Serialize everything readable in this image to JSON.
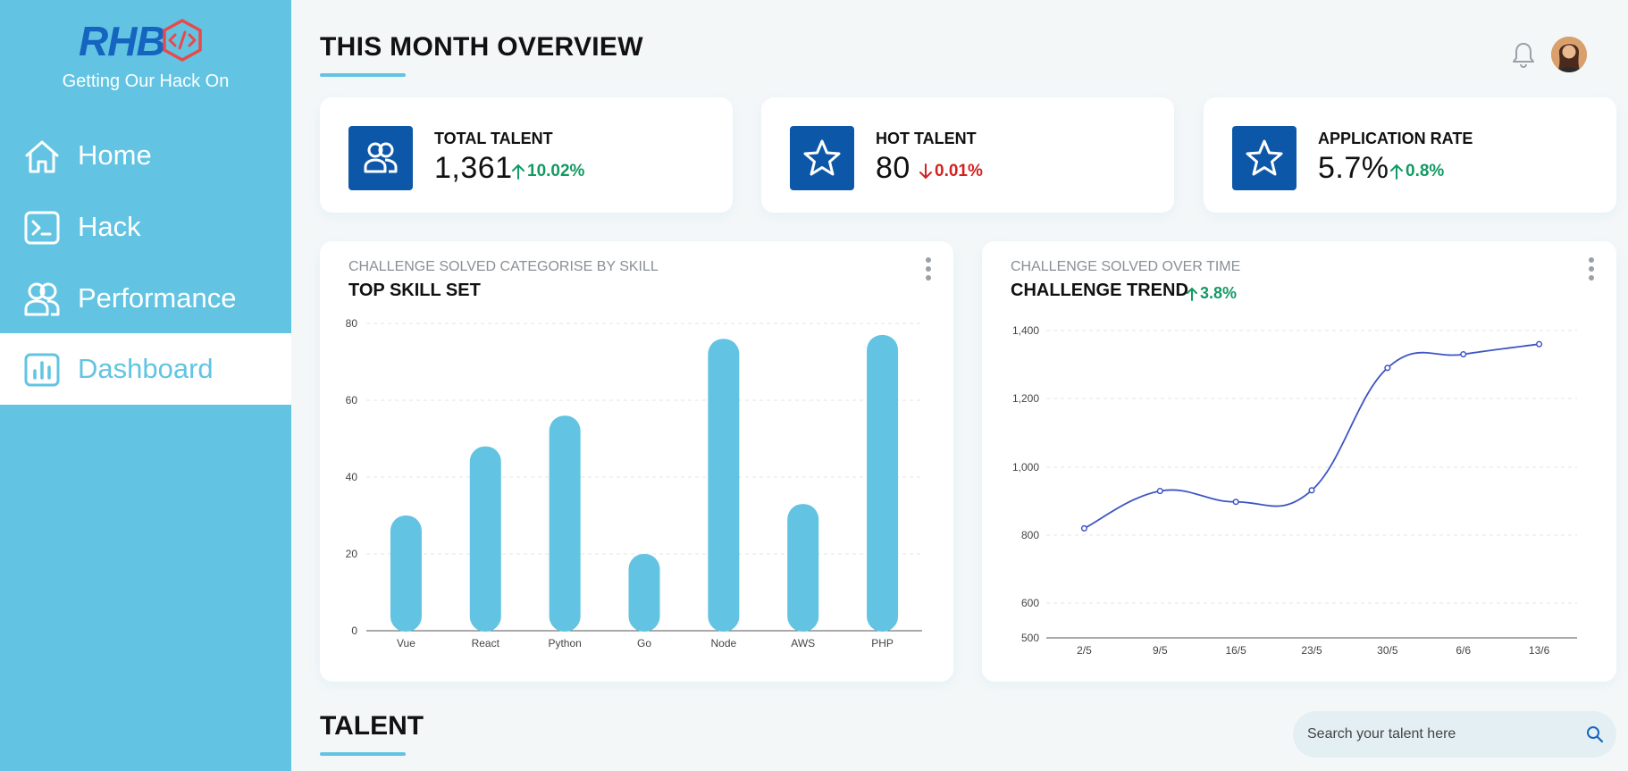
{
  "brand": {
    "logo_text": "RHB",
    "tagline": "Getting Our Hack On",
    "logo_color": "#1565c0",
    "hex_color": "#e84a4a"
  },
  "sidebar": {
    "items": [
      {
        "label": "Home",
        "icon": "home-icon"
      },
      {
        "label": "Hack",
        "icon": "terminal-icon"
      },
      {
        "label": "Performance",
        "icon": "users-icon"
      },
      {
        "label": "Dashboard",
        "icon": "bar-chart-icon",
        "active": true
      }
    ]
  },
  "header": {
    "title": "THIS MONTH OVERVIEW",
    "icons": [
      "bell-icon",
      "avatar"
    ]
  },
  "stats": [
    {
      "label": "TOTAL TALENT",
      "value": "1,361",
      "change": "10.02%",
      "direction": "up",
      "icon": "users-icon"
    },
    {
      "label": "HOT TALENT",
      "value": "80",
      "change": "0.01%",
      "direction": "down",
      "icon": "star-icon"
    },
    {
      "label": "APPLICATION RATE",
      "value": "5.7%",
      "change": "0.8%",
      "direction": "up",
      "icon": "star-icon"
    }
  ],
  "colors": {
    "accent": "#62c4e2",
    "icon_bg": "#0d57a8",
    "up": "#129a64",
    "down": "#d32121",
    "line": "#3d55c4"
  },
  "chart_data": [
    {
      "type": "bar",
      "subtitle": "CHALLENGE SOLVED CATEGORISE BY SKILL",
      "title": "TOP SKILL SET",
      "categories": [
        "Vue",
        "React",
        "Python",
        "Go",
        "Node",
        "AWS",
        "PHP"
      ],
      "values": [
        30,
        48,
        56,
        20,
        76,
        33,
        77
      ],
      "ylim": [
        0,
        80
      ],
      "yticks": [
        "0",
        "20",
        "40",
        "60",
        "80"
      ],
      "grid": true
    },
    {
      "type": "line",
      "subtitle": "CHALLENGE SOLVED OVER TIME",
      "title": "CHALLENGE TREND",
      "change": "3.8%",
      "direction": "up",
      "categories": [
        "2/5",
        "9/5",
        "16/5",
        "23/5",
        "30/5",
        "6/6",
        "13/6"
      ],
      "values": [
        820,
        930,
        898,
        932,
        1290,
        1330,
        1360
      ],
      "ylim": [
        500,
        1400
      ],
      "yticks": [
        "500",
        "600",
        "800",
        "1,000",
        "1,200",
        "1,400"
      ],
      "grid": true
    }
  ],
  "talent": {
    "title": "TALENT",
    "search_placeholder": "Search your talent here"
  }
}
